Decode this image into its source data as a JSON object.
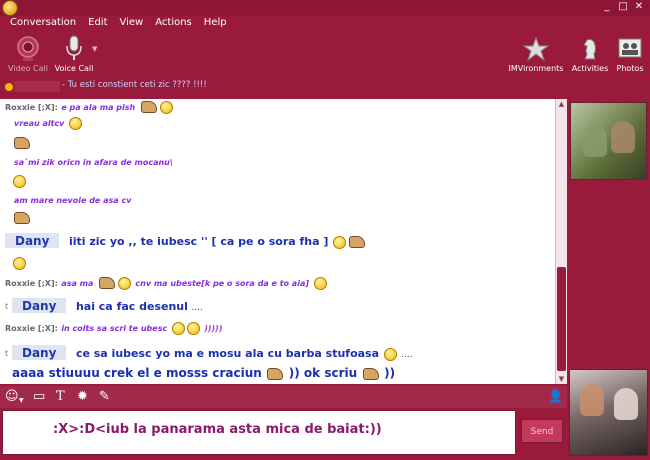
{
  "menu": [
    "Conversation",
    "Edit",
    "View",
    "Actions",
    "Help"
  ],
  "window_controls": [
    "_",
    "□",
    "✕"
  ],
  "toolbar": {
    "video_call": "Video Call",
    "voice_call": "Voice Call",
    "imvironments": "IMVironments",
    "activities": "Activities",
    "photos": "Photos"
  },
  "status": {
    "message": "- Tu esti constient ceti zic ???? !!!!"
  },
  "chat": {
    "speaker": "Roxxie [;X]:",
    "t": "t",
    "m1": "e pa ala ma pish",
    "m2": "vreau altcv",
    "m3": "sa`mi zik oricn in afara de mocanu\\",
    "m4": "am mare nevoie de asa cv",
    "dany": "Dany",
    "m5": "iiti zic yo ,, te iubesc '' [ ca pe o sora fha ]",
    "m6a": "asa ma",
    "m6b": "cnv ma ubeste[k pe o sora da e to aia]",
    "m7": "hai ca fac desenul",
    "m7dots": "....",
    "m8": "in colts sa scri te ubesc",
    "m8b": ")))))",
    "m9": "ce sa iubesc yo ma e mosu ala cu barba stufoasa",
    "m9dots": "....",
    "m10a": "aaaa stiuuuu crek el e mosss craciun",
    "m10b": ")) ok scriu",
    "m10c": "))"
  },
  "input": {
    "text": ":X>:D<iub la panarama asta mica de baiat:))",
    "send": "Send"
  },
  "colors": {
    "window_bg": "#9a1a3c",
    "accent_purple": "#8a2be2",
    "blue_text": "#1c2fb0"
  }
}
